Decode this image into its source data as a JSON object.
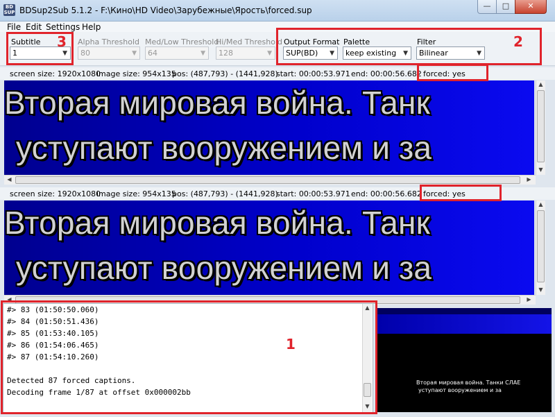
{
  "window": {
    "icon_text": "BD\nSUP",
    "title": "BDSup2Sub 5.1.2 - F:\\Кино\\HD Video\\Зарубежные\\Ярость\\forced.sup",
    "min_glyph": "—",
    "max_glyph": "□",
    "close_glyph": "✕"
  },
  "menu": [
    "File",
    "Edit",
    "Settings",
    "Help"
  ],
  "toolbar": {
    "subtitle": {
      "label": "Subtitle",
      "value": "1"
    },
    "alpha": {
      "label": "Alpha Threshold",
      "value": "80"
    },
    "medlow": {
      "label": "Med/Low Threshold",
      "value": "64"
    },
    "himed": {
      "label": "Hi/Med Threshold",
      "value": "128"
    },
    "output": {
      "label": "Output Format",
      "value": "SUP(BD)"
    },
    "palette": {
      "label": "Palette",
      "value": "keep existing"
    },
    "filter": {
      "label": "Filter",
      "value": "Bilinear"
    }
  },
  "status_top": {
    "screen": "screen size: 1920x1080",
    "image": "image size: 954x135",
    "pos": "pos: (487,793) - (1441,928)",
    "start": "start: 00:00:53.971",
    "end": "end: 00:00:56.682",
    "forced": "forced: yes"
  },
  "status_bottom": {
    "screen": "screen size: 1920x1080",
    "image": "image size: 954x135",
    "pos": "pos: (487,793) - (1441,928)",
    "start": "start: 00:00:53.971",
    "end": "end: 00:00:56.682",
    "forced": "forced: yes"
  },
  "subtitle_text": {
    "line1": "Вторая мировая война. Танк",
    "line2": "уступают вооружением и за"
  },
  "log_lines": [
    "#> 83 (01:50:50.060)",
    "#> 84 (01:50:51.436)",
    "#> 85 (01:53:40.105)",
    "#> 86 (01:54:06.465)",
    "#> 87 (01:54:10.260)",
    "",
    "Detected 87 forced captions.",
    "Decoding frame 1/87 at offset 0x000002bb"
  ],
  "preview": {
    "line1": "Вторая мировая война. Танки СЛАЕ",
    "line2": "уступают вооружением и за"
  },
  "annotations": {
    "log": "1",
    "output_group": "2",
    "subtitle_select": "3"
  },
  "colors": {
    "annotation": "#e0232b",
    "subtitle_bg": "#0000cc",
    "subtitle_text": "#d2d2d2"
  }
}
